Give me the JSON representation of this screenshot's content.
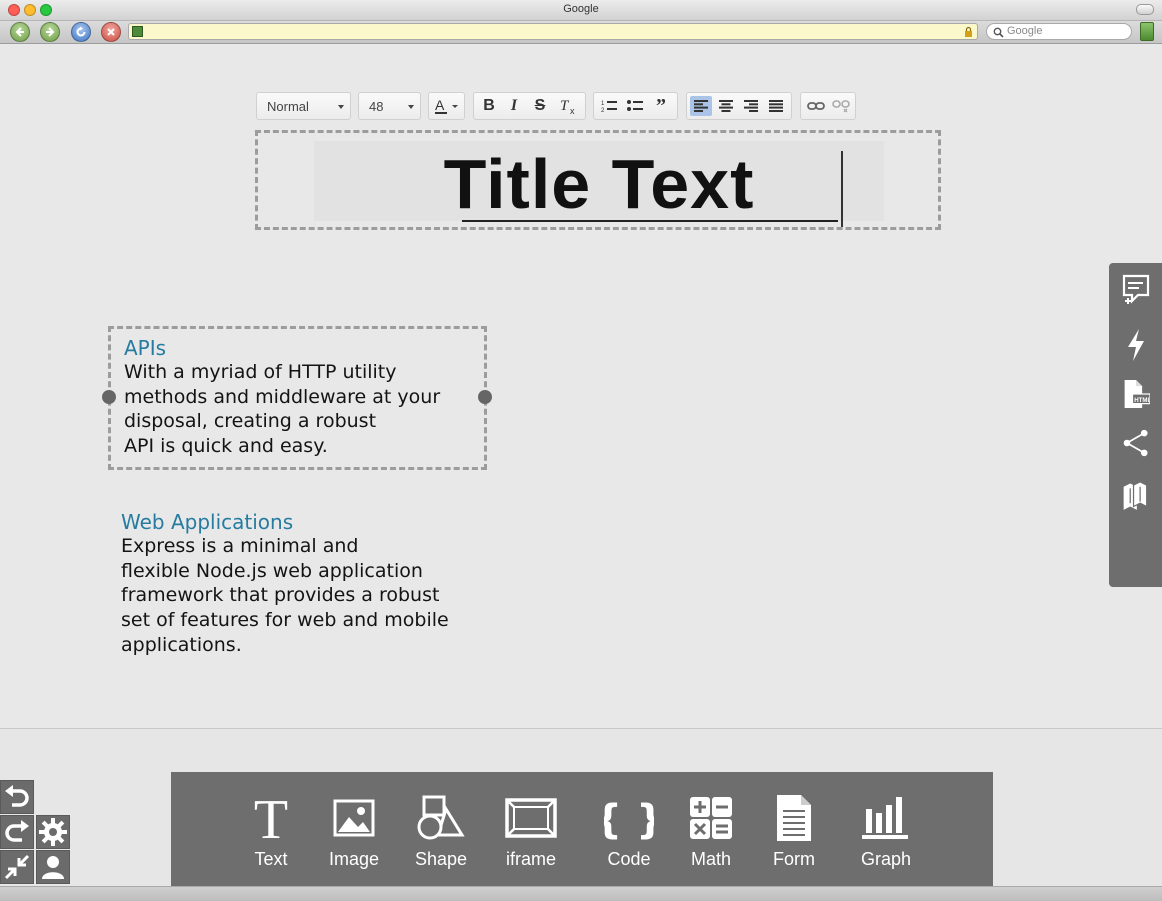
{
  "window": {
    "title": "Google"
  },
  "browser": {
    "search_placeholder": "Google"
  },
  "editor_toolbar": {
    "format": "Normal",
    "font_size": "48",
    "buttons": [
      "font-color",
      "bold",
      "italic",
      "strikethrough",
      "remove-format",
      "ordered-list",
      "bullet-list",
      "blockquote",
      "align-left",
      "align-center",
      "align-right",
      "align-justify",
      "link",
      "unlink"
    ],
    "active_alignment": "align-left"
  },
  "title_block": {
    "text": "Title Text"
  },
  "blocks": [
    {
      "heading": "APIs",
      "lines": [
        "With a myriad of HTTP utility",
        "methods and middleware at your",
        "disposal, creating a robust",
        "API is quick and easy."
      ]
    },
    {
      "heading": "Web Applications",
      "lines": [
        "Express is a minimal and",
        "flexible Node.js web application",
        "framework that provides a robust",
        "set of features for web and mobile",
        "applications."
      ]
    }
  ],
  "side_panel": {
    "icons": [
      "add-note-icon",
      "lightning-icon",
      "html-file-icon",
      "share-icon",
      "books-icon"
    ]
  },
  "insert_toolbar": {
    "items": [
      {
        "label": "Text",
        "icon": "text-icon"
      },
      {
        "label": "Image",
        "icon": "image-icon"
      },
      {
        "label": "Shape",
        "icon": "shape-icon"
      },
      {
        "label": "iframe",
        "icon": "iframe-icon"
      },
      {
        "label": "Code",
        "icon": "code-icon"
      },
      {
        "label": "Math",
        "icon": "math-icon"
      },
      {
        "label": "Form",
        "icon": "form-icon"
      },
      {
        "label": "Graph",
        "icon": "graph-icon"
      }
    ]
  },
  "controls": [
    "undo-icon",
    "redo-icon",
    "gear-icon",
    "collapse-icon",
    "user-icon"
  ],
  "colors": {
    "heading": "#267ca0",
    "panel": "#6e6e6e",
    "active_button": "#a9c4e6"
  }
}
